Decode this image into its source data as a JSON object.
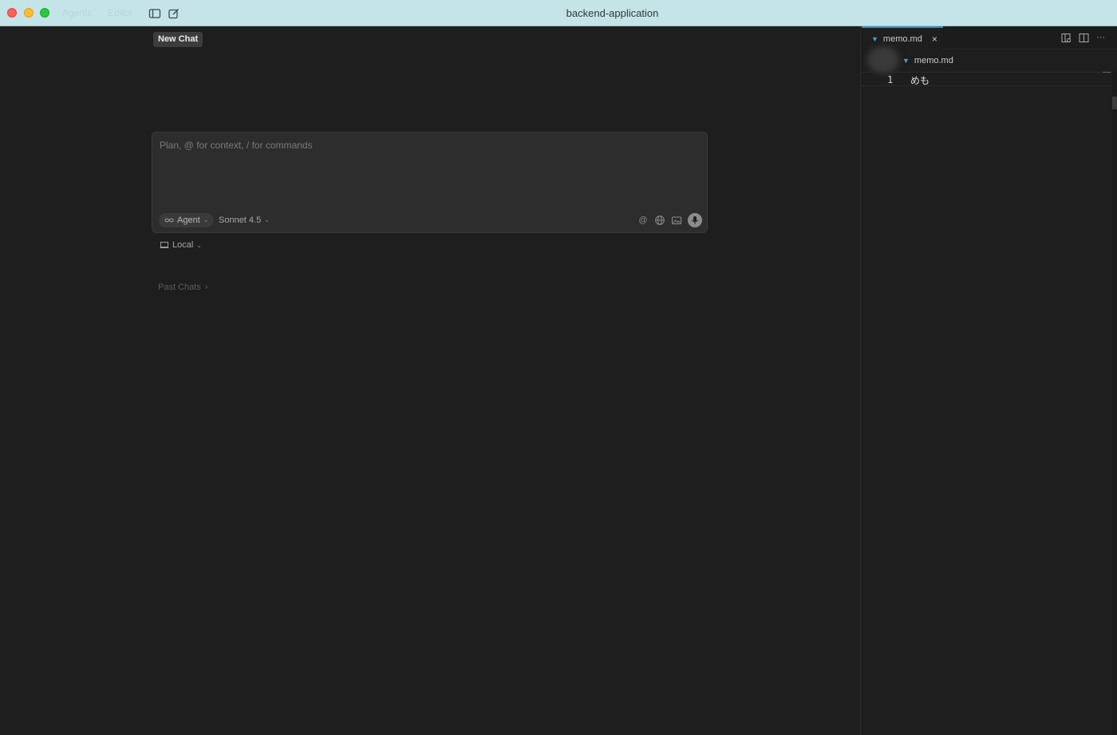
{
  "titlebar": {
    "modes": [
      "Agents",
      "Editor"
    ],
    "window_title": "backend-application",
    "icons": [
      "sidebar-toggle-icon",
      "new-chat-icon"
    ]
  },
  "tooltip": {
    "text": "New Chat"
  },
  "chat": {
    "placeholder": "Plan, @ for context, / for commands",
    "mode_label": "Agent",
    "model_label": "Sonnet 4.5",
    "tools": [
      "at-mention-icon",
      "globe-icon",
      "image-icon",
      "microphone-icon"
    ],
    "environment_label": "Local",
    "past_chats_label": "Past Chats",
    "past_chats_chevron": "›"
  },
  "editor": {
    "tab": {
      "filename": "memo.md",
      "close_glyph": "×"
    },
    "breadcrumb": {
      "filename": "memo.md"
    },
    "lines": [
      {
        "number": "1",
        "text": "めも"
      }
    ],
    "actions": [
      "open-preview-icon",
      "split-editor-icon",
      "more-actions-icon"
    ]
  },
  "colors": {
    "titlebar_bg": "#c5e4e8",
    "background": "#1e1e1e",
    "input_bg": "#2d2d2d",
    "accent": "#3a86c8",
    "markdown_icon": "#4f9fd1"
  }
}
